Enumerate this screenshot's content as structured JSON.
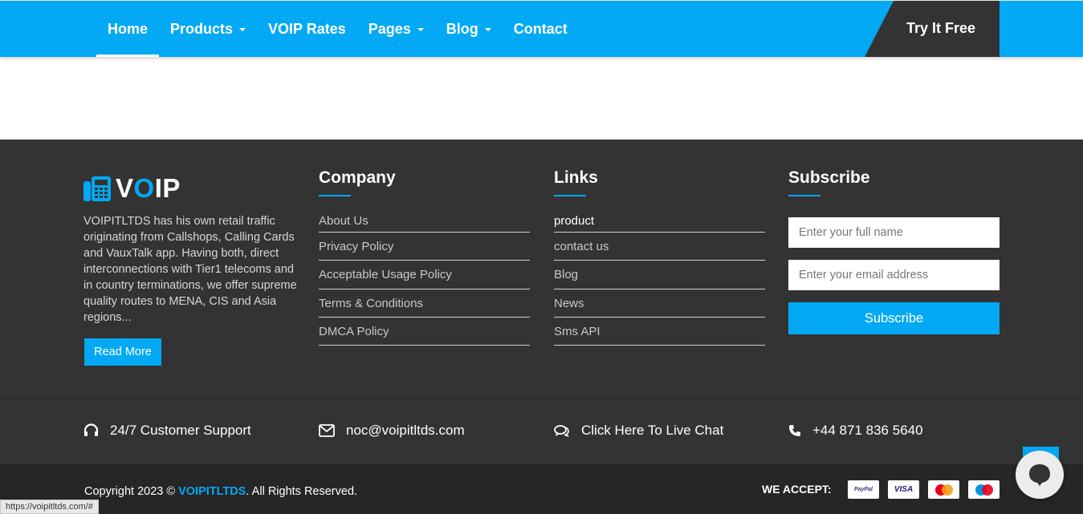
{
  "nav": {
    "items": [
      {
        "label": "Home",
        "dropdown": false,
        "active": true
      },
      {
        "label": "Products",
        "dropdown": true,
        "active": false
      },
      {
        "label": "VOIP Rates",
        "dropdown": false,
        "active": false
      },
      {
        "label": "Pages",
        "dropdown": true,
        "active": false
      },
      {
        "label": "Blog",
        "dropdown": true,
        "active": false
      },
      {
        "label": "Contact",
        "dropdown": false,
        "active": false
      }
    ],
    "cta": "Try It Free"
  },
  "footer": {
    "logo": {
      "prefix": "V",
      "accent": "O",
      "suffix": "IP"
    },
    "about": "VOIPITLTDS has his own retail traffic originating from Callshops, Calling Cards and VauxTalk app. Having both, direct interconnections with Tier1 telecoms and in country terminations, we offer supreme quality routes to MENA, CIS and Asia regions...",
    "read_more": "Read More",
    "company": {
      "title": "Company",
      "links": [
        "About Us",
        "Privacy Policy",
        "Acceptable Usage Policy",
        "Terms & Conditions",
        "DMCA Policy"
      ]
    },
    "links": {
      "title": "Links",
      "links": [
        "product",
        "contact us",
        "Blog",
        "News",
        "Sms API"
      ]
    },
    "subscribe": {
      "title": "Subscribe",
      "name_placeholder": "Enter your full name",
      "email_placeholder": "Enter your email address",
      "button": "Subscribe"
    }
  },
  "contact_bar": {
    "support": "24/7 Customer Support",
    "email": "noc@voipitltds.com",
    "chat": "Click Here To Live Chat",
    "phone": "+44 871 836 5640"
  },
  "bottom": {
    "copyright_prefix": "Copyright 2023 ©",
    "brand": "VOIPITLTDS",
    "copyright_suffix": ". All Rights Reserved.",
    "we_accept": "WE ACCEPT:",
    "cards": [
      "PayPal",
      "VISA",
      "MasterCard",
      "Maestro"
    ]
  },
  "status_bar_url": "https://voipitltds.com/#",
  "colors": {
    "accent": "#03a9f4",
    "dark": "#333333",
    "darker": "#262626"
  }
}
